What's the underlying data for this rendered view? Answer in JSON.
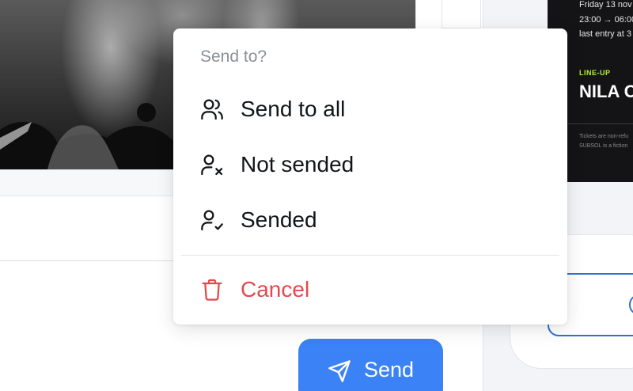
{
  "menu": {
    "title": "Send to?",
    "items": [
      {
        "label": "Send to all",
        "icon": "users-icon"
      },
      {
        "label": "Not sended",
        "icon": "user-x-icon"
      },
      {
        "label": "Sended",
        "icon": "user-check-icon"
      }
    ],
    "cancel": {
      "label": "Cancel",
      "icon": "trash-icon",
      "color": "#e5484d"
    }
  },
  "send_button": {
    "label": "Send",
    "icon": "send-icon",
    "color": "#3b82f6"
  },
  "ticket": {
    "date": "Friday 13 nov",
    "time": "23:00 → 06:00",
    "entry": "last entry at 3",
    "lineup_label": "LINE-UP",
    "artist": "NILA C",
    "fine_print_1": "Tickets are non-refu",
    "fine_print_2": "SUBSOL is a fiction",
    "accent": "#b8f035"
  }
}
